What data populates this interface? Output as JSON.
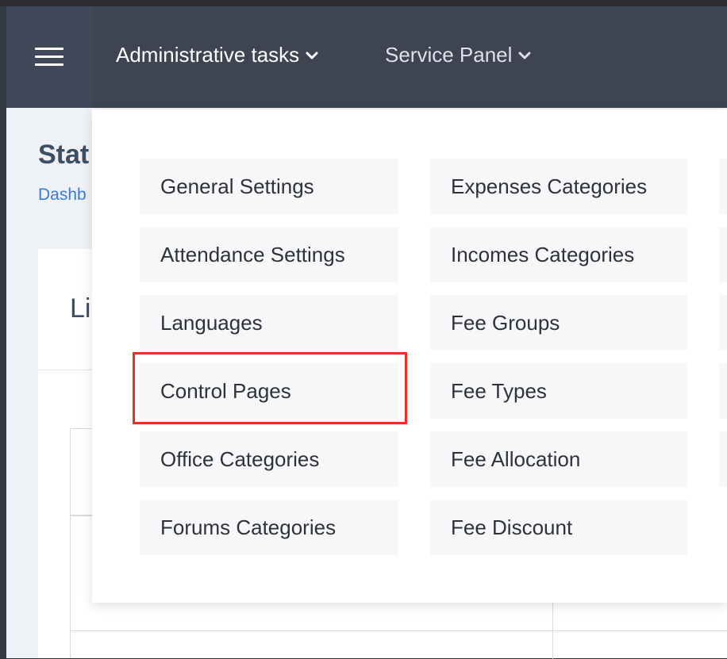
{
  "navbar": {
    "menu_icon": "hamburger-menu-icon",
    "admin_tasks_label": "Administrative tasks",
    "service_panel_label": "Service Panel",
    "chevron_icon": "chevron-down-icon"
  },
  "page": {
    "title": "Stat",
    "breadcrumb": "Dashb",
    "card_title": "Li"
  },
  "dropdown": {
    "column1": [
      "General Settings",
      "Attendance Settings",
      "Languages",
      "Control Pages",
      "Office Categories",
      "Forums Categories"
    ],
    "column2": [
      "Expenses Categories",
      "Incomes Categories",
      "Fee Groups",
      "Fee Types",
      "Fee Allocation",
      "Fee Discount"
    ],
    "highlighted_item": "Control Pages",
    "highlight_color": "#e53228"
  }
}
